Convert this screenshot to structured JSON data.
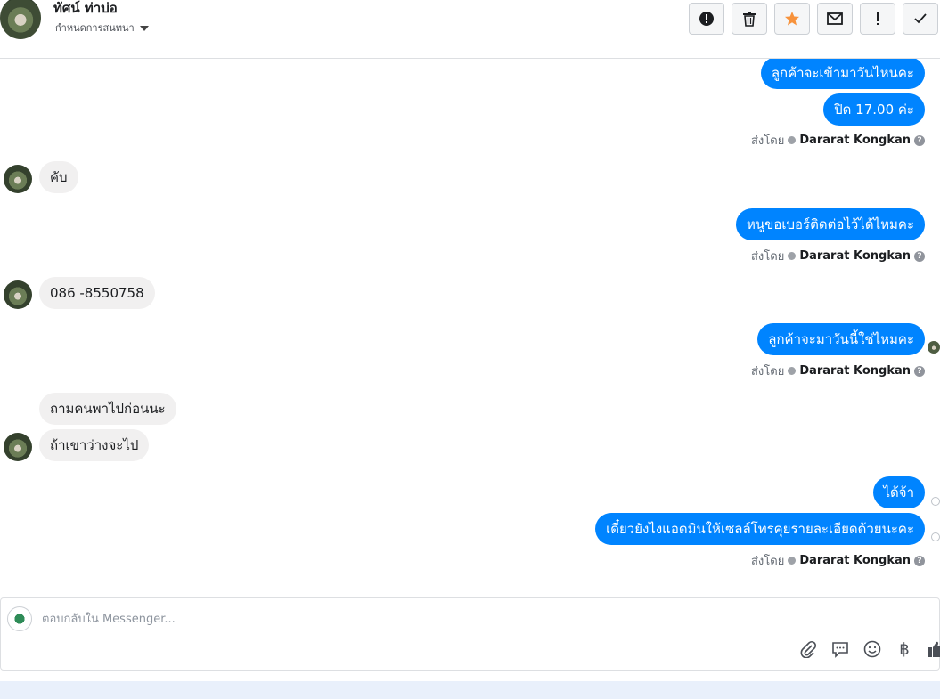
{
  "header": {
    "name": "ทัศน์ ท่าบ่อ",
    "subtitle": "กำหนดการสนทนา",
    "toolbar": [
      {
        "name": "spam-button",
        "icon": "alert-circle-icon"
      },
      {
        "name": "delete-button",
        "icon": "trash-icon"
      },
      {
        "name": "star-button",
        "icon": "star-icon",
        "color": "#f7923b"
      },
      {
        "name": "mark-unread-button",
        "icon": "envelope-icon"
      },
      {
        "name": "flag-button",
        "icon": "exclamation-icon"
      },
      {
        "name": "done-button",
        "icon": "checkmark-icon"
      }
    ]
  },
  "thread": {
    "messages": [
      {
        "side": "out",
        "text": "ลูกค้าจะเข้ามาวันไหนคะ"
      },
      {
        "side": "out",
        "text": "ปิด 17.00 ค่ะ"
      },
      {
        "side": "in",
        "text": "คับ"
      },
      {
        "side": "out",
        "text": "หนูขอเบอร์ติดต่อไว้ได้ไหมคะ"
      },
      {
        "side": "in",
        "text": "086 -8550758"
      },
      {
        "side": "out",
        "text": "ลูกค้าจะมาวันนี้ใช่ไหมคะ"
      },
      {
        "side": "in",
        "text": "ถามคนพาไปก่อนนะ"
      },
      {
        "side": "in",
        "text": "ถ้าเขาว่างจะไป"
      },
      {
        "side": "out",
        "text": "ได้จ้า"
      },
      {
        "side": "out",
        "text": "เดี๋ยวยังไงแอดมินให้เซลล์โทรคุยรายละเอียดด้วยนะคะ"
      }
    ],
    "sent_by_label": "ส่งโดย",
    "sent_by_name": "Dararat Kongkan",
    "help_glyph": "?"
  },
  "composer": {
    "placeholder": "ตอบกลับใน Messenger...",
    "icons": [
      "paperclip-icon",
      "chat-bubble-icon",
      "smiley-icon",
      "baht-icon",
      "thumbs-up-icon"
    ],
    "baht_glyph": "฿"
  },
  "colors": {
    "outgoing": "#0084ff",
    "incoming": "#f1f0f0",
    "accent_star": "#f7923b"
  }
}
